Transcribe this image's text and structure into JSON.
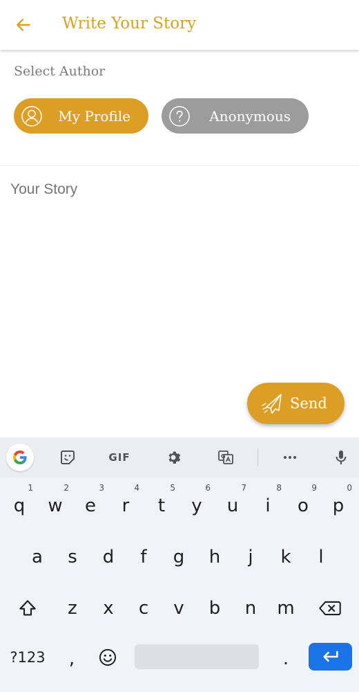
{
  "header": {
    "title": "Write Your Story",
    "back_icon": "arrow-left-icon"
  },
  "author": {
    "label": "Select Author",
    "options": [
      {
        "label": "My Profile",
        "icon": "user-circle-icon",
        "selected": true,
        "color": "#dc9e24"
      },
      {
        "label": "Anonymous",
        "icon": "question-circle-icon",
        "selected": false,
        "color": "#9c9c9c"
      }
    ]
  },
  "story": {
    "placeholder": "Your Story",
    "value": ""
  },
  "send": {
    "label": "Send",
    "icon": "paper-plane-icon"
  },
  "colors": {
    "accent": "#d9a11f",
    "enter_key": "#1b73e8"
  },
  "keyboard": {
    "toolbar": [
      "google-icon",
      "sticker-icon",
      "GIF",
      "gear-icon",
      "translate-icon",
      "more-icon",
      "mic-icon"
    ],
    "gif_label": "GIF",
    "row1": [
      {
        "k": "q",
        "h": "1"
      },
      {
        "k": "w",
        "h": "2"
      },
      {
        "k": "e",
        "h": "3"
      },
      {
        "k": "r",
        "h": "4"
      },
      {
        "k": "t",
        "h": "5"
      },
      {
        "k": "y",
        "h": "6"
      },
      {
        "k": "u",
        "h": "7"
      },
      {
        "k": "i",
        "h": "8"
      },
      {
        "k": "o",
        "h": "9"
      },
      {
        "k": "p",
        "h": "0"
      }
    ],
    "row2": [
      "a",
      "s",
      "d",
      "f",
      "g",
      "h",
      "j",
      "k",
      "l"
    ],
    "row3": [
      "z",
      "x",
      "c",
      "v",
      "b",
      "n",
      "m"
    ],
    "symbols_label": "?123",
    "comma": ",",
    "period": "."
  }
}
